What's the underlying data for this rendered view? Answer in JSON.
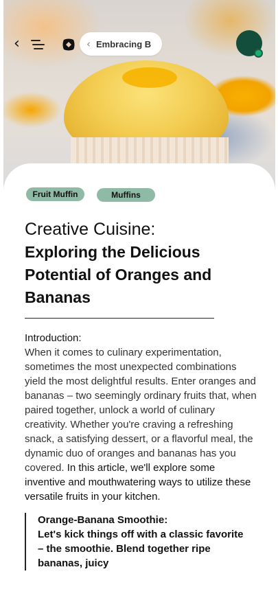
{
  "header": {
    "breadcrumb": "Embracing B",
    "icons": {
      "back": "back-arrow-icon",
      "menu": "menu-icon",
      "logo": "logo-icon",
      "breadcrumb_chevron": "chevron-left-icon"
    },
    "avatar_color": "#134d3b",
    "status_dot_color": "#17b06e"
  },
  "article": {
    "tags": [
      "Fruit Muffin",
      "Muffins"
    ],
    "title_part1": "Creative Cuisine:",
    "title_part2": "Exploring the Delicious Potential of Oranges and Bananas",
    "intro_label": "Introduction:",
    "intro_text": "When it comes to culinary experimentation, sometimes the most unexpected combinations yield the most delightful results. Enter oranges and bananas – two seemingly ordinary fruits that, when paired together, unlock a world of culinary creativity. Whether you're craving a refreshing snack, a satisfying dessert, or a flavorful meal, the dynamic duo of oranges and bananas has you covered.",
    "intro_text_dark": " In this article, we'll explore some inventive and mouthwatering ways to utilize these versatile fruits in your kitchen.",
    "quote_heading": "Orange-Banana Smoothie:",
    "quote_text": "Let's kick things off with a classic favorite – the smoothie. Blend together ripe bananas, juicy"
  },
  "colors": {
    "tag_bg": "#8fbaa6",
    "accent": "#134d3b"
  }
}
